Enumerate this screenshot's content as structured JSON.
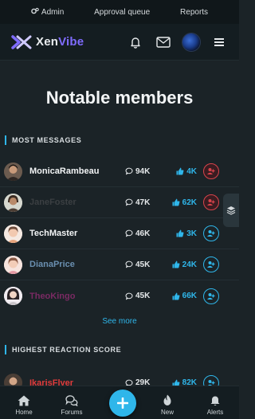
{
  "admin_bar": {
    "admin_label": "Admin",
    "approval_label": "Approval queue",
    "reports_label": "Reports"
  },
  "header": {
    "logo_part1": "Xen",
    "logo_part2": "Vibe",
    "brand_color": "#7f6cff"
  },
  "page": {
    "title": "Notable members"
  },
  "sections": {
    "most_messages": "MOST MESSAGES",
    "highest_reaction": "HIGHEST REACTION SCORE",
    "see_more": "See more"
  },
  "members": [
    {
      "name": "MonicaRambeau",
      "name_color": "#f2f4f5",
      "messages": "94K",
      "reactions": "4K",
      "followed": true
    },
    {
      "name": "JaneFoster",
      "name_color": "#3b3f42",
      "messages": "47K",
      "reactions": "62K",
      "followed": true
    },
    {
      "name": "TechMaster",
      "name_color": "#f2f4f5",
      "messages": "46K",
      "reactions": "3K",
      "followed": false
    },
    {
      "name": "DianaPrice",
      "name_color": "#6a8fb0",
      "messages": "45K",
      "reactions": "24K",
      "followed": false
    },
    {
      "name": "TheoKingo",
      "name_color": "#7a2a63",
      "messages": "45K",
      "reactions": "66K",
      "followed": false
    }
  ],
  "reaction_members": [
    {
      "name": "IkarisFlyer",
      "name_color": "#e03b3b",
      "messages": "29K",
      "reactions": "82K",
      "followed": false
    }
  ],
  "bottom_nav": {
    "home": "Home",
    "forums": "Forums",
    "new": "New",
    "alerts": "Alerts"
  },
  "colors": {
    "accent": "#2fb6ea",
    "follow_active": "#d9434b",
    "background": "#1b2327"
  },
  "icons": [
    "cogs-icon",
    "bell-icon",
    "envelope-icon",
    "menu-icon",
    "comment-icon",
    "thumbs-up-icon",
    "user-plus-icon",
    "layers-icon",
    "home-icon",
    "comments-icon",
    "fire-icon",
    "plus-icon"
  ]
}
